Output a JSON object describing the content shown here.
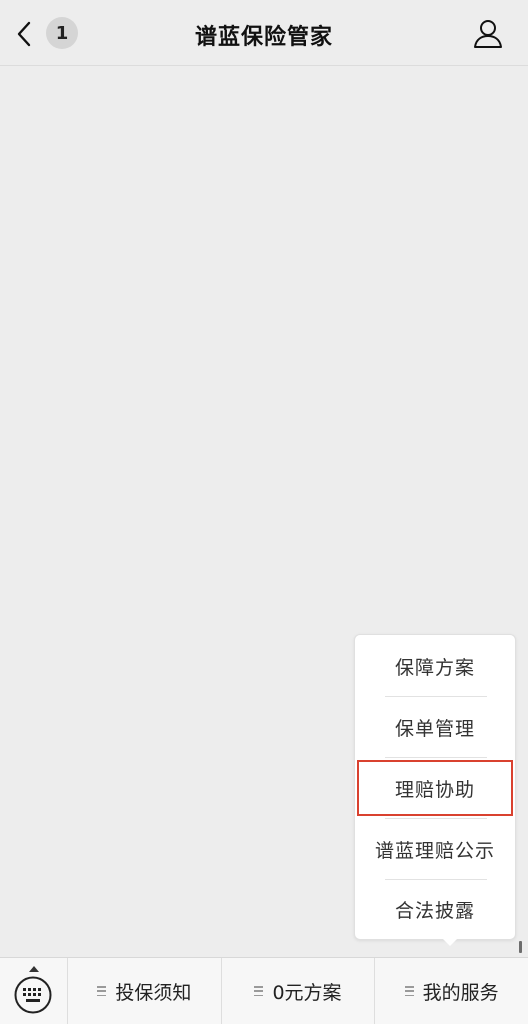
{
  "header": {
    "title": "谱蓝保险管家",
    "unread_count": "1"
  },
  "icons": {
    "back": "chevron-left-icon",
    "profile": "person-icon",
    "keyboard": "keyboard-icon",
    "menu": "menu-lines-icon"
  },
  "popup_menu": {
    "items": [
      {
        "label": "保障方案"
      },
      {
        "label": "保单管理"
      },
      {
        "label": "理赔协助"
      },
      {
        "label": "谱蓝理赔公示"
      },
      {
        "label": "合法披露"
      }
    ],
    "highlighted_index": 2,
    "highlight_color": "#d9412f"
  },
  "bottom_bar": {
    "tabs": [
      {
        "label": "投保须知"
      },
      {
        "label": "0元方案"
      },
      {
        "label": "我的服务"
      }
    ]
  },
  "colors": {
    "background": "#ededed",
    "popup": "#ffffff",
    "text": "#222222"
  }
}
